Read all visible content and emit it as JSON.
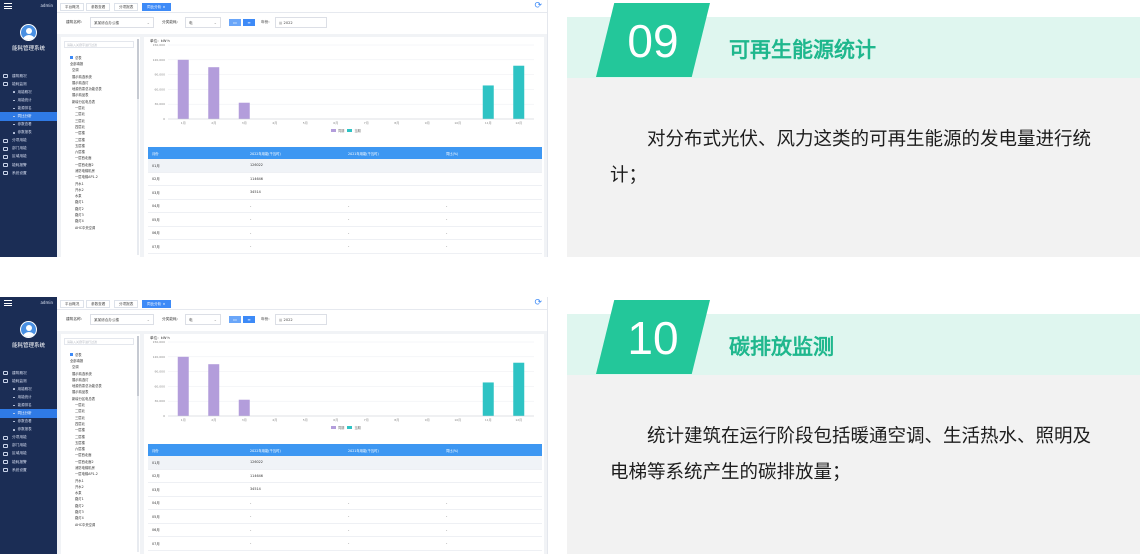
{
  "sections": [
    {
      "number": "09",
      "title": "可再生能源统计",
      "description": "对分布式光伏、风力这类的可再生能源的发电量进行统计；"
    },
    {
      "number": "10",
      "title": "碳排放监测",
      "description": "统计建筑在运行阶段包括暖通空调、生活热水、照明及电梯等系统产生的碳排放量；"
    }
  ],
  "app": {
    "system_name": "能耗管理系统",
    "user": "admin",
    "menu": [
      {
        "label": "建筑概况",
        "sub": false
      },
      {
        "label": "能耗监测",
        "sub": false
      },
      {
        "label": "用能概况",
        "sub": true
      },
      {
        "label": "用能统计",
        "sub": true
      },
      {
        "label": "能源排名",
        "sub": true
      },
      {
        "label": "同比分析",
        "sub": true,
        "active": true
      },
      {
        "label": "参数查看",
        "sub": true
      },
      {
        "label": "参数报表",
        "sub": true
      },
      {
        "label": "分项用能",
        "sub": false
      },
      {
        "label": "部门用能",
        "sub": false
      },
      {
        "label": "区域用能",
        "sub": false
      },
      {
        "label": "能耗报警",
        "sub": false
      },
      {
        "label": "系统设置",
        "sub": false
      }
    ],
    "tabs": [
      "平台概况",
      "参数查看",
      "分项报表",
      "同比分析 ×"
    ],
    "filter": {
      "building_label": "建筑名称:",
      "building_value": "某某综合办公楼",
      "type_label": "分类能耗:",
      "type_value": "电",
      "year_label": "年份:",
      "year_value": "2022",
      "mode_buttons": [
        "▭",
        "≡"
      ]
    },
    "tree_search_placeholder": "请输入关键字进行过滤",
    "tree_items": [
      "总表",
      "全部填报",
      "空调",
      "展示精选系统",
      "展示精选灯",
      "地源热泵总功能总表",
      "展示精品表",
      "新增分区电总表",
      "一层北",
      "二层北",
      "三层北",
      "四层北",
      "一层楼",
      "二层楼",
      "五层楼",
      "六层楼",
      "一层西北面",
      "一层西北面2",
      "消防电梯机房",
      "一层电梯AP1-2",
      "开水1",
      "开水2",
      "水泵",
      "路灯1",
      "路灯2",
      "路灯3",
      "路灯4",
      "AHC中央空调"
    ],
    "unit": "单位：kW·h",
    "chart_data": {
      "type": "bar",
      "categories": [
        "1月",
        "2月",
        "3月",
        "4月",
        "5月",
        "6月",
        "7月",
        "8月",
        "9月",
        "10月",
        "11月",
        "12月"
      ],
      "series": [
        {
          "name": "同期",
          "color": "#b39ddb",
          "values": [
            120000,
            105000,
            33000,
            0,
            0,
            0,
            0,
            0,
            0,
            0,
            0,
            0
          ]
        },
        {
          "name": "当期",
          "color": "#2ec3c4",
          "values": [
            0,
            0,
            0,
            0,
            0,
            0,
            0,
            0,
            0,
            0,
            68000,
            108000
          ]
        }
      ],
      "yticks": [
        "0",
        "30,000",
        "60,000",
        "90,000",
        "120,000",
        "150,000"
      ],
      "ylim": [
        0,
        150000
      ]
    },
    "table": {
      "headers": [
        "月份",
        "2022年用能(千瓦时)",
        "2021年用能(千瓦时)",
        "同比(%)"
      ],
      "rows": [
        [
          "01月",
          "126022",
          "",
          ""
        ],
        [
          "02月",
          "114646",
          "",
          ""
        ],
        [
          "03月",
          "34514",
          "",
          ""
        ],
        [
          "04月",
          "-",
          "-",
          "-"
        ],
        [
          "05月",
          "-",
          "-",
          "-"
        ],
        [
          "06月",
          "-",
          "-",
          "-"
        ],
        [
          "07月",
          "-",
          "-",
          "-"
        ]
      ]
    }
  }
}
